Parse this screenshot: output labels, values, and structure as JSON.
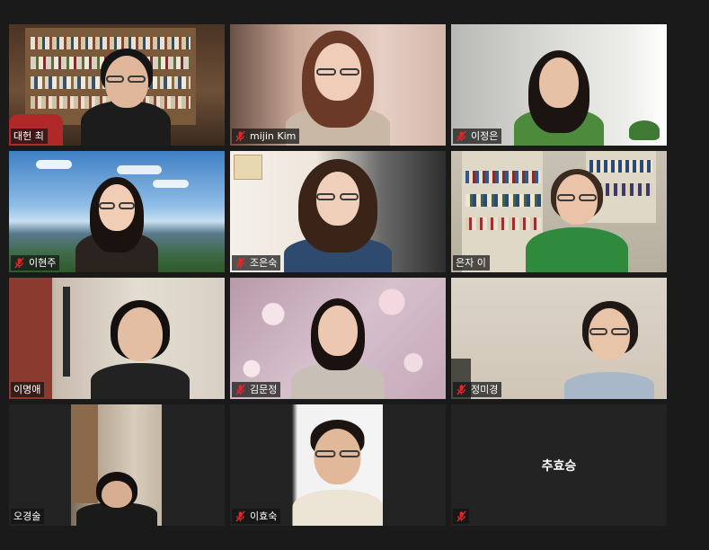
{
  "participants": [
    {
      "name": "대헌 최",
      "muted": false
    },
    {
      "name": "mijin Kim",
      "muted": true
    },
    {
      "name": "이정은",
      "muted": true
    },
    {
      "name": "이현주",
      "muted": true
    },
    {
      "name": "조은숙",
      "muted": true
    },
    {
      "name": "은자 이",
      "muted": false
    },
    {
      "name": "이명애",
      "muted": false
    },
    {
      "name": "김문정",
      "muted": true
    },
    {
      "name": "정미경",
      "muted": true
    },
    {
      "name": "오경술",
      "muted": false
    },
    {
      "name": "이효숙",
      "muted": true
    },
    {
      "name": "추효승",
      "muted": true
    }
  ],
  "colors": {
    "background": "#1a1a1a",
    "active_speaker_border": "#dbe640",
    "mute_icon": "#e02828"
  },
  "icons": {
    "mute": "microphone-muted-icon"
  }
}
